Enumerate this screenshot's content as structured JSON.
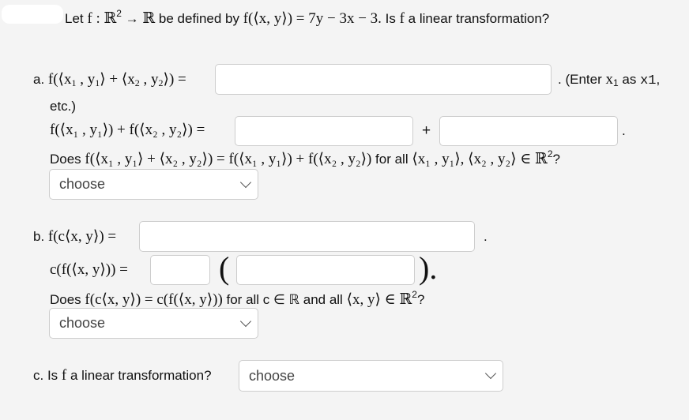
{
  "intro": {
    "prefix": "Let ",
    "f": "f",
    "colon": " : ",
    "domain": "ℝ",
    "domain_exp": "2",
    "arrow": " → ",
    "codomain": "ℝ",
    "defined_by": " be defined by ",
    "formula": "f(⟨x, y⟩) = 7y − 3x − 3.",
    "question_prefix": " Is ",
    "question_f": "f",
    "question_suffix": "  a linear transformation?"
  },
  "part_a": {
    "label": "a. ",
    "lhs_1": "f(⟨x",
    "lhs_2": " , y",
    "lhs_3": "⟩ + ⟨x",
    "lhs_4": " , y",
    "lhs_5": "⟩) =",
    "sub1": "1",
    "sub2": "2",
    "answer1_value": "",
    "hint_prefix": ". (Enter ",
    "hint_var": "x",
    "hint_var_sub": "1",
    "hint_mid": "  as ",
    "hint_code": "x1",
    "hint_suffix": ",",
    "hint_cont": "etc.)",
    "sum_lhs": "f(⟨x₁ , y₁⟩) + f(⟨x₂ , y₂⟩) =",
    "answer2_value": "",
    "plus": "+",
    "answer3_value": "",
    "period": ".",
    "question_prefix": "Does ",
    "question_math": "f(⟨x₁ , y₁⟩ + ⟨x₂ , y₂⟩) = f(⟨x₁ , y₁⟩) + f(⟨x₂ , y₂⟩)",
    "question_mid": " for all ",
    "question_vars": "⟨x₁ , y₁⟩, ⟨x₂ , y₂⟩ ∈ ℝ",
    "question_exp": "2",
    "question_end": "?",
    "dropdown_selected": "choose"
  },
  "part_b": {
    "label": "b. ",
    "lhs": "f(c⟨x, y⟩) =",
    "answer1_value": "",
    "period": ".",
    "scalar_lhs": "c(f(⟨x, y⟩)) =",
    "answer2_value": "",
    "open_paren": "(",
    "answer3_value": "",
    "close_paren": ").",
    "question_prefix": "Does ",
    "question_math": "f(c⟨x, y⟩) = c(f(⟨x, y⟩))",
    "question_mid": " for all c ∈ ℝ and all ",
    "question_vars": "⟨x, y⟩ ∈ ℝ",
    "question_exp": "2",
    "question_end": "?",
    "dropdown_selected": "choose"
  },
  "part_c": {
    "label": "c. Is ",
    "f": "f",
    "text": "  a linear transformation?",
    "dropdown_selected": "choose"
  }
}
